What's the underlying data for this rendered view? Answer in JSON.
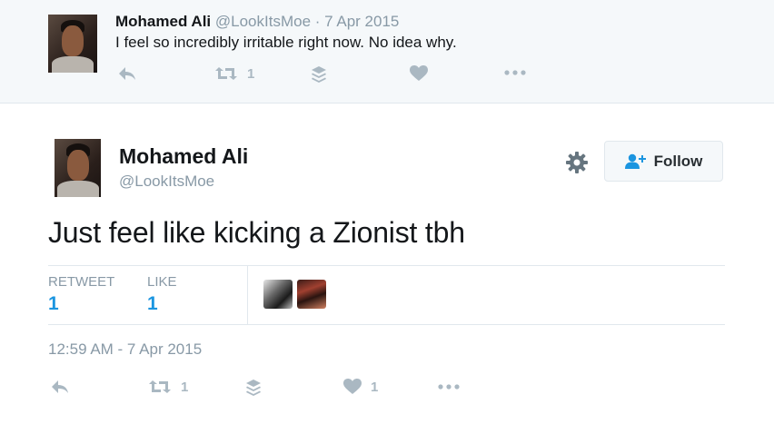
{
  "parent_tweet": {
    "name": "Mohamed Ali",
    "meta": "@LookItsMoe · 7 Apr 2015",
    "text": "I feel so incredibly irritable right now. No idea why.",
    "retweet_count": "1",
    "icons": [
      "reply-icon",
      "retweet-icon",
      "layers-icon",
      "heart-icon",
      "more-icon"
    ]
  },
  "main_tweet": {
    "name": "Mohamed Ali",
    "handle": "@LookItsMoe",
    "follow_label": "Follow",
    "text": "Just feel like kicking a Zionist tbh",
    "stats": {
      "retweet_label": "RETWEET",
      "retweet_value": "1",
      "like_label": "LIKE",
      "like_value": "1"
    },
    "timestamp": "12:59 AM - 7 Apr 2015",
    "actions": {
      "retweet_count": "1",
      "like_count": "1"
    }
  },
  "colors": {
    "link_blue": "#1b95e0",
    "muted": "#8899a6",
    "icon_gray": "#aab8c2",
    "parent_bg": "#f5f8fa"
  }
}
